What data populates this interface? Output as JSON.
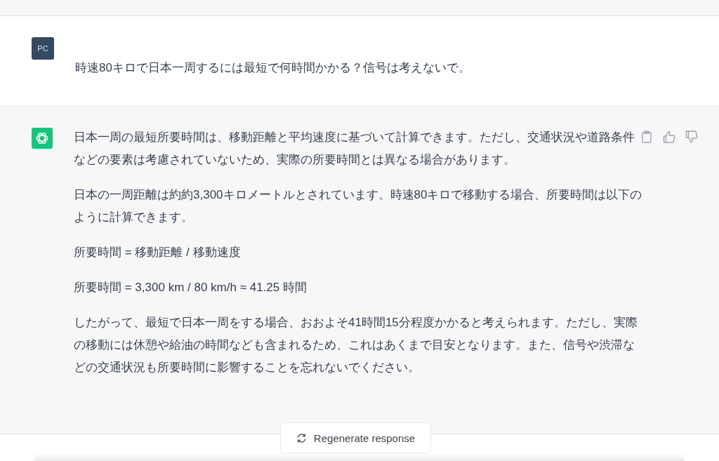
{
  "user_message": {
    "avatar": "PC",
    "text": "時速80キロで日本一周するには最短で何時間かかる？信号は考えないで。"
  },
  "assistant_message": {
    "paragraphs": [
      "日本一周の最短所要時間は、移動距離と平均速度に基づいて計算できます。ただし、交通状況や道路条件などの要素は考慮されていないため、実際の所要時間とは異なる場合があります。",
      "日本の一周距離は約約3,300キロメートルとされています。時速80キロで移動する場合、所要時間は以下のように計算できます。",
      "所要時間 = 移動距離 / 移動速度",
      "所要時間 = 3,300 km / 80 km/h ≈ 41.25 時間",
      "したがって、最短で日本一周をする場合、おおよそ41時間15分程度かかると考えられます。ただし、実際の移動には休憩や給油の時間なども含まれるため、これはあくまで目安となります。また、信号や渋滞などの交通状況も所要時間に影響することを忘れないでください。"
    ]
  },
  "regenerate_button": {
    "label": "Regenerate response"
  }
}
